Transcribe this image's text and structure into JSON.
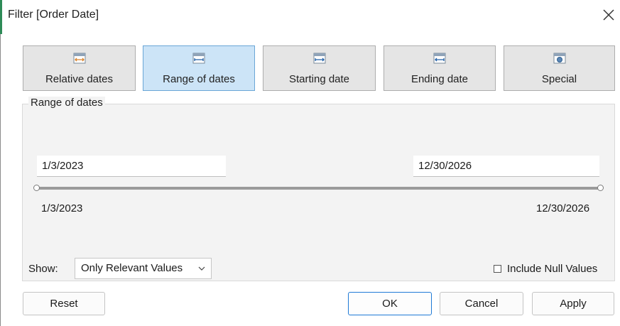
{
  "dialog": {
    "title": "Filter [Order Date]"
  },
  "tabs": [
    {
      "label": "Relative dates",
      "icon": "relative-dates-calendar-icon"
    },
    {
      "label": "Range of dates",
      "icon": "range-of-dates-calendar-icon",
      "active": true
    },
    {
      "label": "Starting date",
      "icon": "starting-date-calendar-icon"
    },
    {
      "label": "Ending date",
      "icon": "ending-date-calendar-icon"
    },
    {
      "label": "Special",
      "icon": "special-calendar-icon"
    }
  ],
  "range": {
    "group_label": "Range of dates",
    "start_value": "1/3/2023",
    "end_value": "12/30/2026",
    "min_label": "1/3/2023",
    "max_label": "12/30/2026"
  },
  "show": {
    "label": "Show:",
    "selected": "Only Relevant Values"
  },
  "include_null": {
    "label": "Include Null Values",
    "checked": false
  },
  "buttons": {
    "reset": "Reset",
    "ok": "OK",
    "cancel": "Cancel",
    "apply": "Apply"
  },
  "colors": {
    "active_tab": "#cce4f7",
    "active_tab_border": "#6aa6d6",
    "primary_button_border": "#1f7ad6",
    "group_background": "#f3f3f3"
  }
}
